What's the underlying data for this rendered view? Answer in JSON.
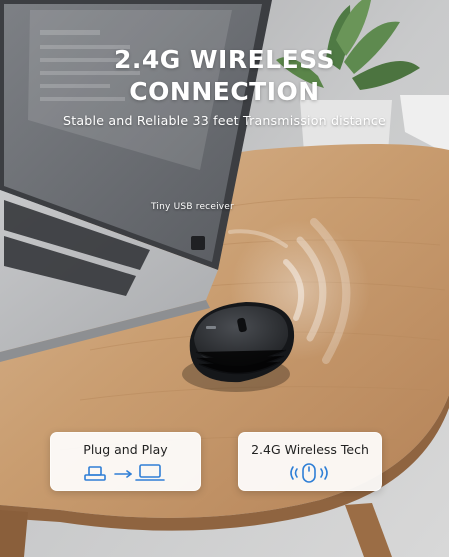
{
  "headline": {
    "line1": "2.4G WIRELESS",
    "line2": "CONNECTION"
  },
  "subtitle": "Stable and Reliable 33 feet Transmission distance",
  "callout": "Tiny USB receiver",
  "badges": [
    {
      "label": "Plug and Play",
      "icons": [
        "usb-receiver-icon",
        "arrow-right-icon",
        "laptop-icon"
      ]
    },
    {
      "label": "2.4G Wireless Tech",
      "icons": [
        "wireless-mouse-icon"
      ]
    }
  ],
  "colors": {
    "badge_icon": "#2f7fd6",
    "headline": "#ffffff",
    "table_wood": "#c79a6c",
    "mouse_body": "#2b2d31"
  }
}
